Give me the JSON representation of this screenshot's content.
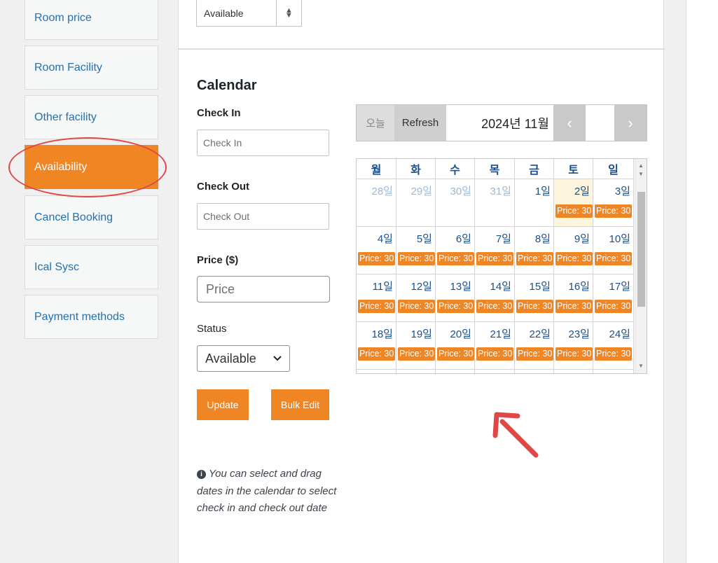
{
  "sidebar": {
    "items": [
      {
        "label": "Room price",
        "active": false
      },
      {
        "label": "Room Facility",
        "active": false
      },
      {
        "label": "Other facility",
        "active": false
      },
      {
        "label": "Availability",
        "active": true
      },
      {
        "label": "Cancel Booking",
        "active": false
      },
      {
        "label": "Ical Sysc",
        "active": false
      },
      {
        "label": "Payment methods",
        "active": false
      }
    ]
  },
  "top_select": {
    "value": "Available"
  },
  "form": {
    "title": "Calendar",
    "check_in_label": "Check In",
    "check_in_placeholder": "Check In",
    "check_out_label": "Check Out",
    "check_out_placeholder": "Check Out",
    "price_label": "Price ($)",
    "price_placeholder": "Price",
    "status_label": "Status",
    "status_value": "Available",
    "update_label": "Update",
    "bulk_edit_label": "Bulk Edit",
    "note": "You can select and drag dates in the calendar to select check in and check out date"
  },
  "calendar": {
    "today_label": "오늘",
    "refresh_label": "Refresh",
    "month_label": "2024년 11월",
    "weekdays": [
      "월",
      "화",
      "수",
      "목",
      "금",
      "토",
      "일"
    ],
    "price_tag": "Price: 30",
    "weeks": [
      [
        {
          "d": "28일",
          "other": true
        },
        {
          "d": "29일",
          "other": true
        },
        {
          "d": "30일",
          "other": true
        },
        {
          "d": "31일",
          "other": true
        },
        {
          "d": "1일"
        },
        {
          "d": "2일",
          "today": true,
          "price": true
        },
        {
          "d": "3일",
          "price": true
        }
      ],
      [
        {
          "d": "4일",
          "price": true
        },
        {
          "d": "5일",
          "price": true
        },
        {
          "d": "6일",
          "price": true
        },
        {
          "d": "7일",
          "price": true
        },
        {
          "d": "8일",
          "price": true
        },
        {
          "d": "9일",
          "price": true
        },
        {
          "d": "10일",
          "price": true
        }
      ],
      [
        {
          "d": "11일",
          "price": true
        },
        {
          "d": "12일",
          "price": true
        },
        {
          "d": "13일",
          "price": true
        },
        {
          "d": "14일",
          "price": true
        },
        {
          "d": "15일",
          "price": true
        },
        {
          "d": "16일",
          "price": true
        },
        {
          "d": "17일",
          "price": true
        }
      ],
      [
        {
          "d": "18일",
          "price": true
        },
        {
          "d": "19일",
          "price": true
        },
        {
          "d": "20일",
          "price": true
        },
        {
          "d": "21일",
          "price": true
        },
        {
          "d": "22일",
          "price": true
        },
        {
          "d": "23일",
          "price": true
        },
        {
          "d": "24일",
          "price": true
        }
      ]
    ]
  },
  "colors": {
    "accent": "#ef8523",
    "link": "#2271b1",
    "annotation": "#e04848"
  }
}
